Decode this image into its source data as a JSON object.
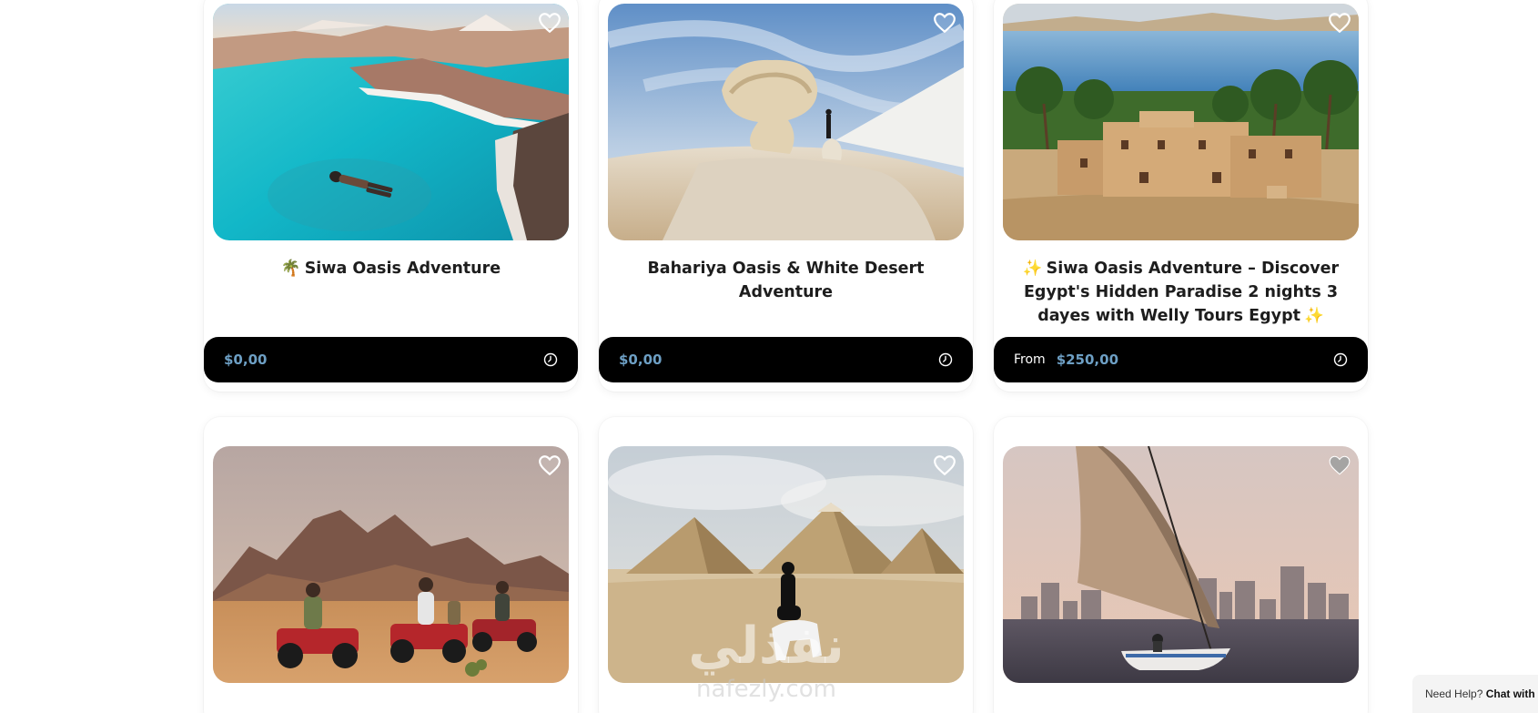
{
  "cards": [
    {
      "title_prefix": "🌴",
      "title": "Siwa Oasis Adventure",
      "title_suffix": "",
      "from_label": "",
      "price": "$0,00",
      "favorite_icon": "heart-outline-icon",
      "duration_icon": "clock-icon"
    },
    {
      "title_prefix": "",
      "title": "Bahariya Oasis & White Desert Adventure",
      "title_suffix": "",
      "from_label": "",
      "price": "$0,00",
      "favorite_icon": "heart-outline-icon",
      "duration_icon": "clock-icon"
    },
    {
      "title_prefix": "✨",
      "title": "Siwa Oasis Adventure – Discover Egypt's Hidden Paradise 2 nights 3 dayes with Welly Tours Egypt",
      "title_suffix": "✨",
      "from_label": "From",
      "price": "$250,00",
      "favorite_icon": "heart-outline-icon",
      "duration_icon": "clock-icon"
    },
    {
      "favorite_icon": "heart-outline-icon"
    },
    {
      "favorite_icon": "heart-outline-icon"
    },
    {
      "favorite_icon": "heart-outline-icon"
    }
  ],
  "watermark": {
    "arabic": "نفذلي",
    "latin": "nafezly.com"
  },
  "help_widget": {
    "prefix": "Need Help?",
    "link": "Chat with us"
  },
  "colors": {
    "price": "#6d9fc4",
    "price_bar": "#000000",
    "heart": "#ffffff"
  }
}
